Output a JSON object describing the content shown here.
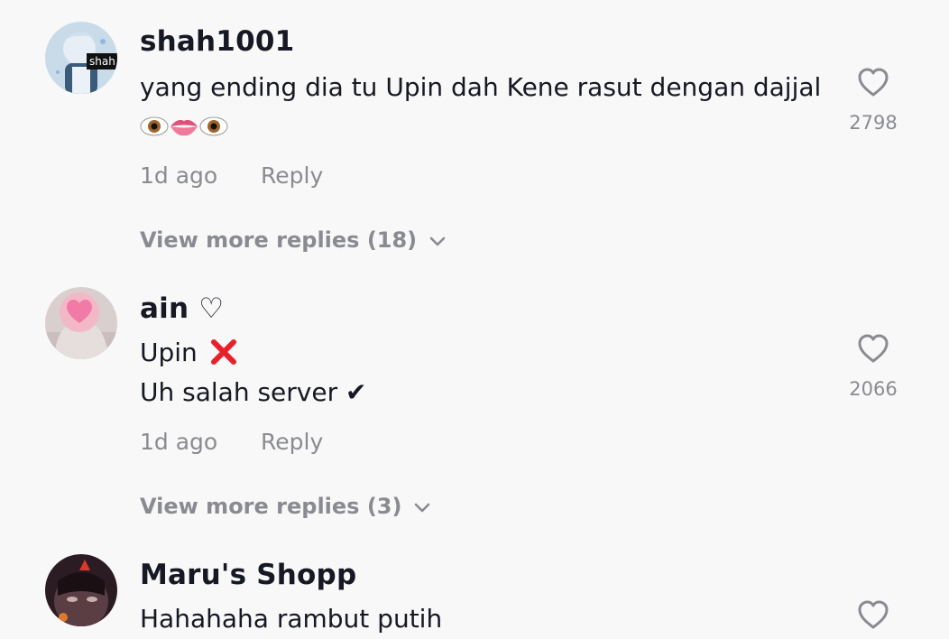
{
  "comments": [
    {
      "username": "shah1001",
      "avatar_label": "shah",
      "text_line1": "yang ending dia tu Upin dah Kene rasut dengan dajjal",
      "emojis": [
        "eyes-emoji",
        "lips-emoji",
        "eyes-emoji"
      ],
      "time": "1d ago",
      "reply_label": "Reply",
      "likes": "2798",
      "view_more": "View more replies (18)"
    },
    {
      "username": "ain",
      "username_suffix": "♡",
      "text_line1": "Upin",
      "text_line1_icon": "red-cross-mark-icon",
      "text_line2": "Uh salah server ✔",
      "time": "1d ago",
      "reply_label": "Reply",
      "likes": "2066",
      "view_more": "View more replies (3)"
    },
    {
      "username": "Maru's Shopp",
      "text_line1": "Hahahaha rambut putih"
    }
  ],
  "colors": {
    "background": "#f8f8f8",
    "primary_text": "#161823",
    "secondary_text": "#8a8b91",
    "red_cross": "#e8202a"
  }
}
